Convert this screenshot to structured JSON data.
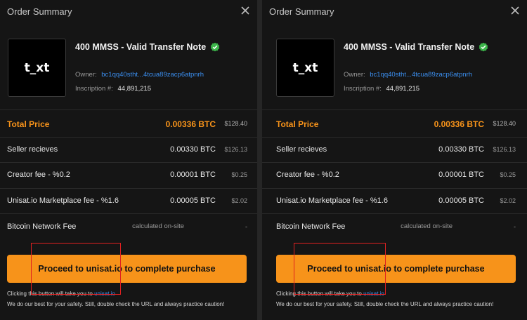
{
  "header": {
    "title": "Order Summary"
  },
  "item": {
    "thumbnail_text": "t_xt",
    "title": "400 MMSS - Valid Transfer Note",
    "owner_label": "Owner:",
    "owner_address": "bc1qq40stht...4tcua89zacp6atpnrh",
    "inscription_label": "Inscription #:",
    "inscription_number": "44,891,215"
  },
  "pricing": {
    "total": {
      "label": "Total Price",
      "btc": "0.00336 BTC",
      "usd": "$128.40"
    },
    "seller": {
      "label": "Seller recieves",
      "btc": "0.00330 BTC",
      "usd": "$126.13"
    },
    "creator_fee": {
      "label": "Creator fee - %0.2",
      "btc": "0.00001 BTC",
      "usd": "$0.25"
    },
    "marketplace_fee": {
      "label": "Unisat.io Marketplace fee - %1.6",
      "btc": "0.00005 BTC",
      "usd": "$2.02"
    },
    "network_fee": {
      "label": "Bitcoin Network Fee",
      "value": "calculated on-site",
      "usd": "-"
    }
  },
  "action": {
    "proceed_label": "Proceed to unisat.io to complete purchase",
    "note_prefix": "Clicking this button will take you to",
    "note_link": "unisat.io",
    "note_safety": "We do our best for your safety. Still, double check the URL and always practice caution!"
  },
  "colors": {
    "accent": "#f7931a",
    "link": "#3b8ff0",
    "highlight": "#e02020",
    "verified": "#3cb54a"
  }
}
